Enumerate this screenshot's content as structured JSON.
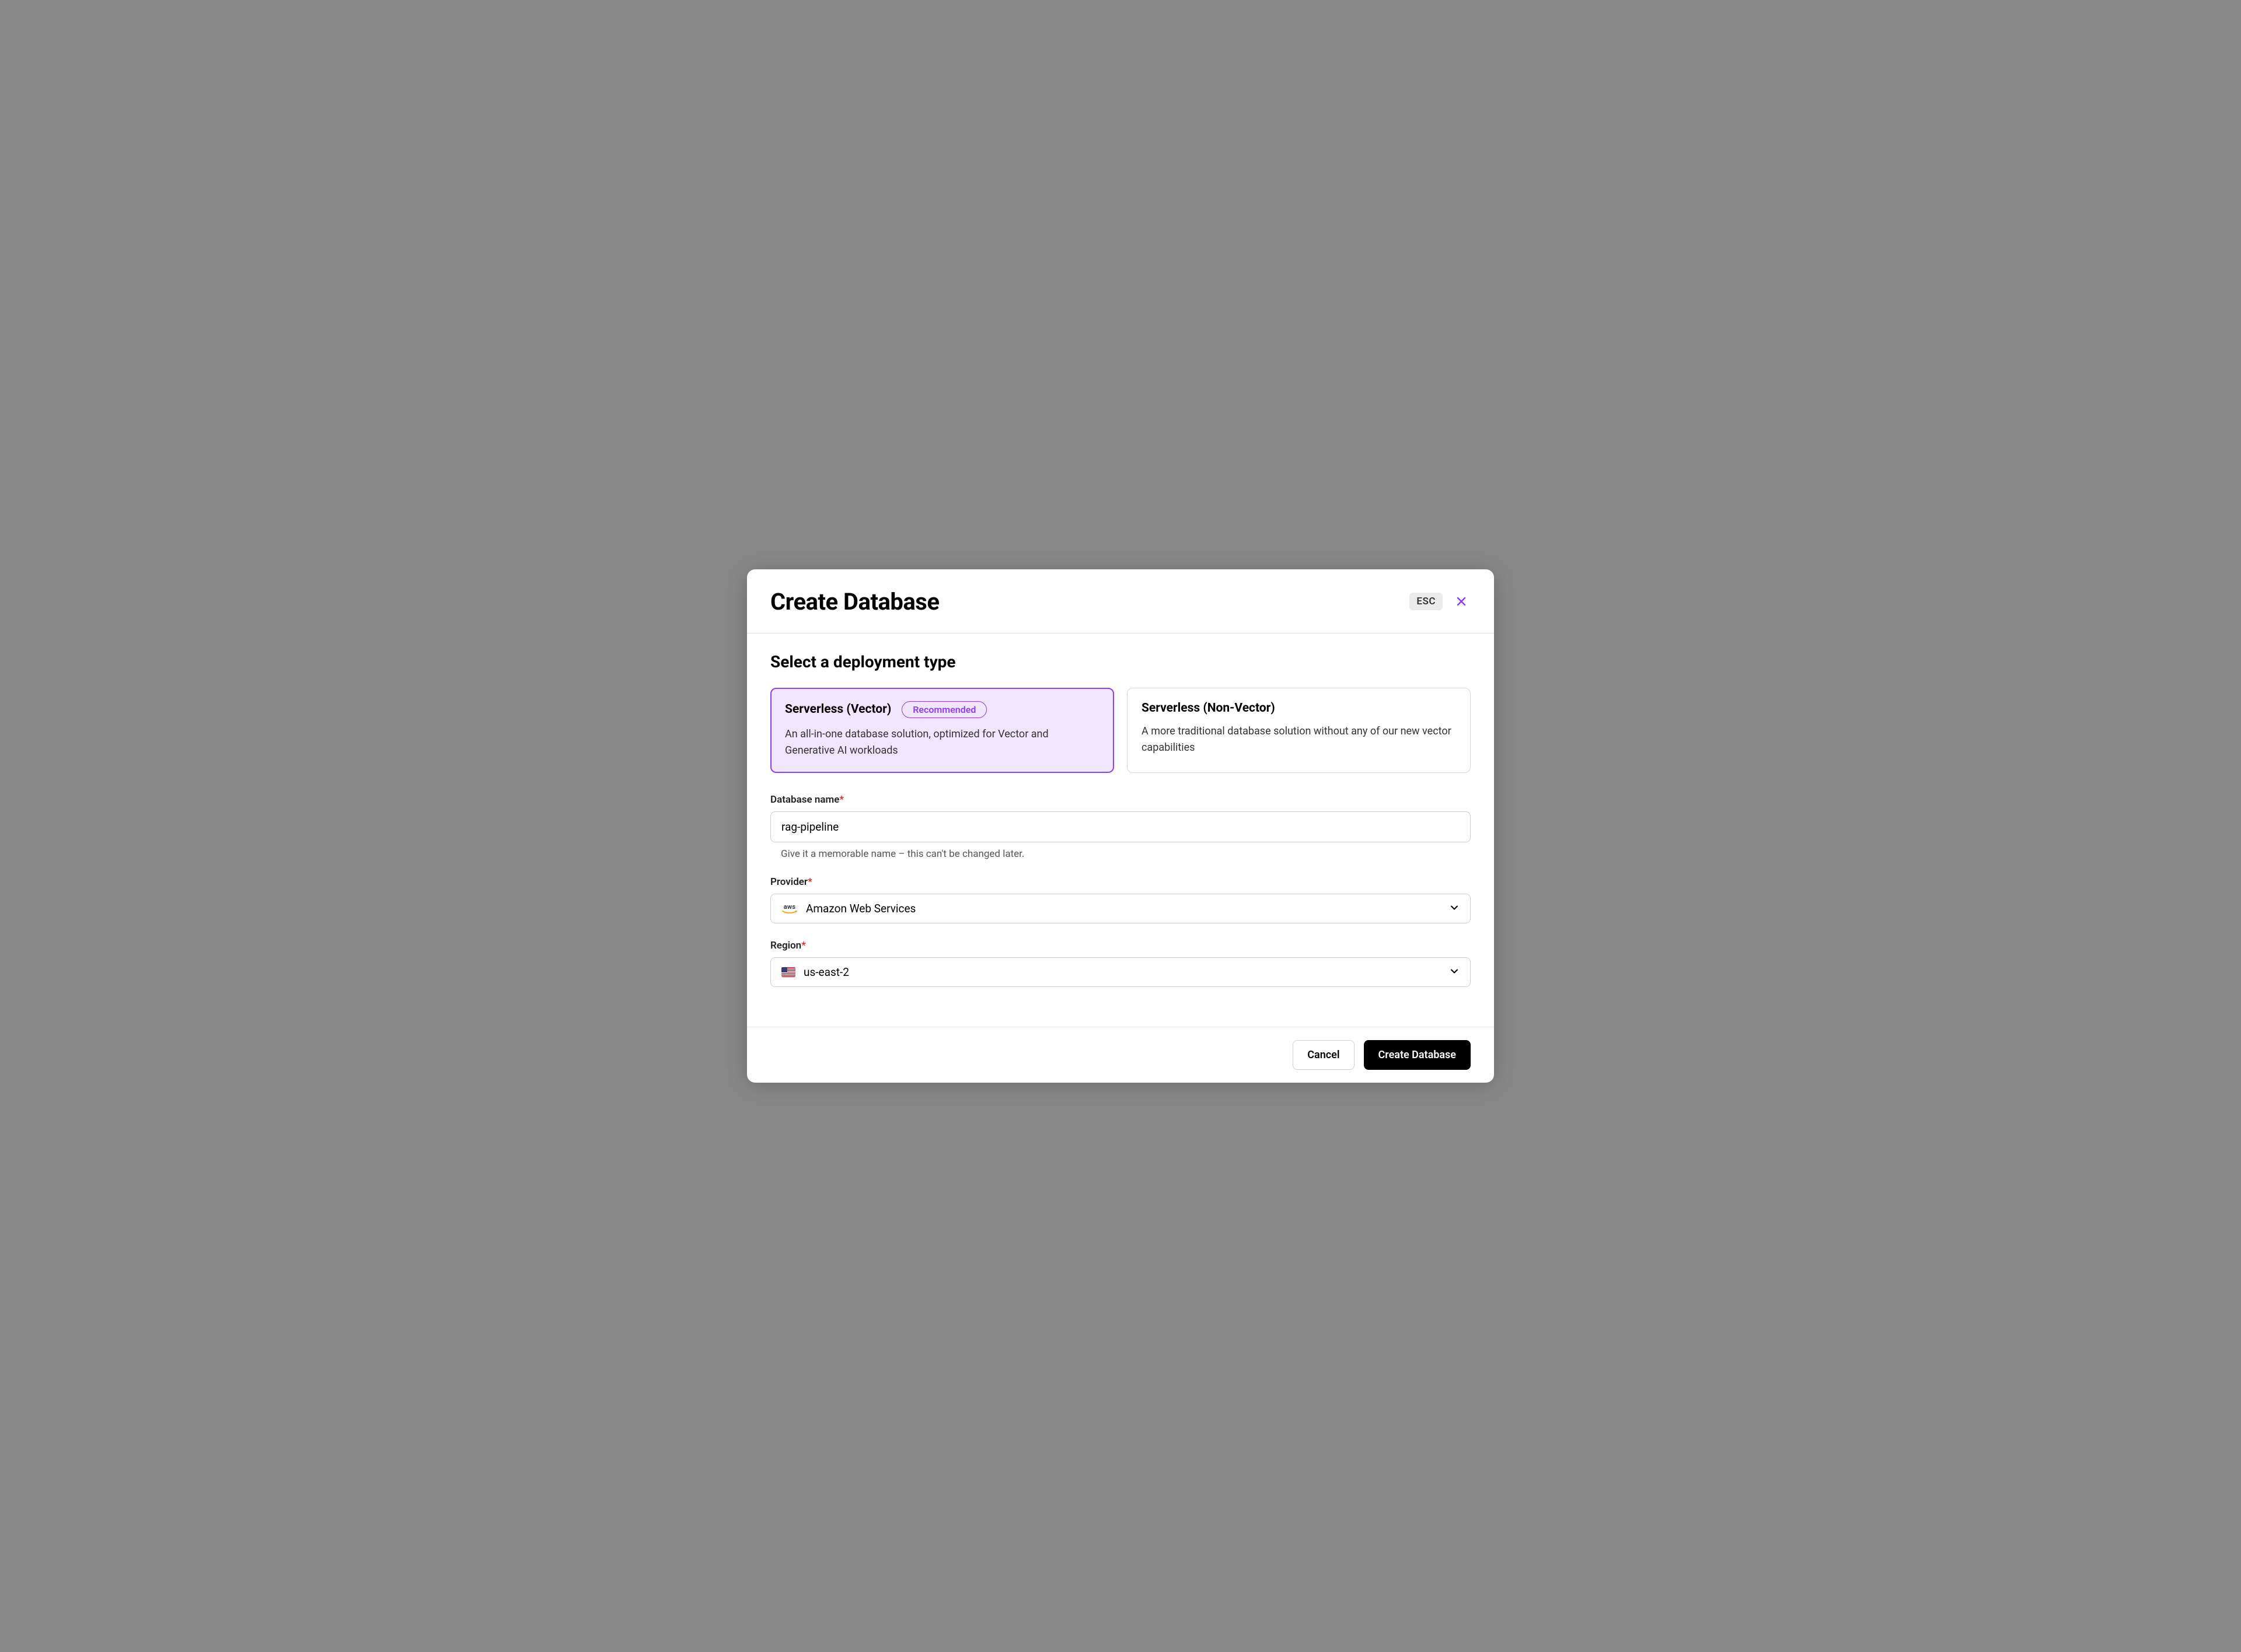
{
  "header": {
    "title": "Create Database",
    "esc_label": "ESC"
  },
  "section": {
    "heading": "Select a deployment type"
  },
  "options": {
    "vector": {
      "title": "Serverless (Vector)",
      "badge": "Recommended",
      "description": "An all-in-one database solution, optimized for Vector and Generative AI workloads"
    },
    "nonvector": {
      "title": "Serverless (Non-Vector)",
      "description": "A more traditional database solution without any of our new vector capabilities"
    }
  },
  "form": {
    "db_name": {
      "label": "Database name",
      "value": "rag-pipeline",
      "help": "Give it a memorable name – this can't be changed later."
    },
    "provider": {
      "label": "Provider",
      "value": "Amazon Web Services",
      "icon_text": "aws"
    },
    "region": {
      "label": "Region",
      "value": "us-east-2"
    }
  },
  "footer": {
    "cancel": "Cancel",
    "submit": "Create Database"
  }
}
